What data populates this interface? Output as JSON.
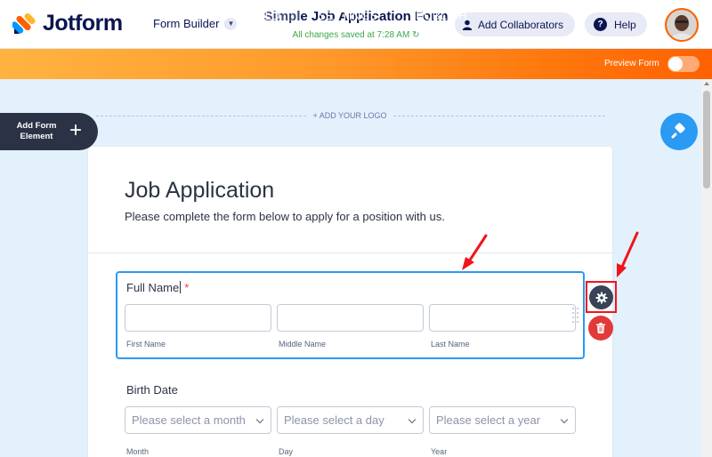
{
  "app": {
    "name": "Jotform",
    "mode_label": "Form Builder",
    "form_title": "Simple Job Application Form",
    "save_status": "All changes saved at 7:28 AM",
    "collaborators_label": "Add Collaborators",
    "help_label": "Help"
  },
  "nav": {
    "tabs": [
      {
        "label": "BUILD",
        "active": true
      },
      {
        "label": "SETTINGS",
        "active": false
      },
      {
        "label": "PUBLISH",
        "active": false
      }
    ],
    "preview_label": "Preview Form",
    "preview_on": false
  },
  "canvas": {
    "add_logo": "+ ADD YOUR LOGO",
    "add_element": "Add Form Element"
  },
  "form": {
    "heading": "Job Application",
    "subheading": "Please complete the form below to apply for a position with us.",
    "full_name": {
      "label": "Full Name",
      "required": "*",
      "sublabels": [
        "First Name",
        "Middle Name",
        "Last Name"
      ]
    },
    "birth_date": {
      "label": "Birth Date",
      "placeholders": [
        "Please select a month",
        "Please select a day",
        "Please select a year"
      ],
      "sublabels": [
        "Month",
        "Day",
        "Year"
      ]
    }
  },
  "colors": {
    "brand_navy": "#0a1551",
    "nav_orange": "#ff6100",
    "selection_blue": "#2a9af3",
    "annotation_red": "#f2141b"
  },
  "icons": {
    "logo": "jotform-logo-icon",
    "collaborators": "user-icon",
    "help": "question-icon",
    "add": "plus-icon",
    "designer": "paint-roller-icon",
    "properties": "gear-icon",
    "delete": "trash-icon",
    "drag": "drag-handle-icon",
    "refresh": "refresh-icon",
    "dropdown": "chevron-down-icon"
  }
}
